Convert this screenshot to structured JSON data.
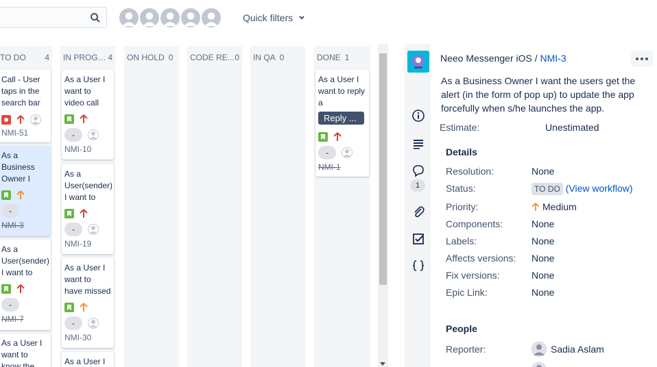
{
  "toolbar": {
    "quick_filters_label": "Quick filters"
  },
  "columns": [
    {
      "name": "TO DO",
      "count": "4"
    },
    {
      "name": "IN PROGR...",
      "count": "4"
    },
    {
      "name": "ON HOLD",
      "count": "0"
    },
    {
      "name": "CODE RE...",
      "count": "0"
    },
    {
      "name": "IN QA",
      "count": "0"
    },
    {
      "name": "DONE",
      "count": "1"
    }
  ],
  "cards": {
    "todo": [
      {
        "summary": "Call - User taps in the search bar",
        "key": "NMI-51"
      },
      {
        "summary": "As a Business Owner I",
        "estimate": "-",
        "key": "NMI-3"
      },
      {
        "summary": "As a User(sender) I want to",
        "estimate": "-",
        "key": "NMI-7"
      },
      {
        "summary": "As a User I want to know the"
      }
    ],
    "inprogress": [
      {
        "summary": "As a User I want to video call",
        "estimate": "-",
        "key": "NMI-10"
      },
      {
        "summary": "As a User(sender) I want to",
        "estimate": "-",
        "key": "NMI-19"
      },
      {
        "summary": "As a User I want to have missed",
        "estimate": "-",
        "key": "NMI-30"
      },
      {
        "summary": "As a User I"
      }
    ],
    "done": [
      {
        "summary": "As a User I want to reply a",
        "button": "Reply ...",
        "estimate": "-",
        "key": "NMI-1"
      }
    ]
  },
  "detail": {
    "project": "Neeo Messenger iOS",
    "separator": "/",
    "issue_key": "NMI-3",
    "summary": "As a Business Owner I want the users get the alert (in the form of pop up) to update the app forcefully when s/he launches the app.",
    "comment_count": "1",
    "estimate_label": "Estimate:",
    "estimate_value": "Unestimated",
    "details_title": "Details",
    "fields": {
      "resolution_label": "Resolution:",
      "resolution_value": "None",
      "status_label": "Status:",
      "status_value": "TO DO",
      "status_link": "(View workflow)",
      "priority_label": "Priority:",
      "priority_value": "Medium",
      "components_label": "Components:",
      "components_value": "None",
      "labels_label": "Labels:",
      "labels_value": "None",
      "affects_label": "Affects versions:",
      "affects_value": "None",
      "fix_label": "Fix versions:",
      "fix_value": "None",
      "epic_label": "Epic Link:",
      "epic_value": "None"
    },
    "people_title": "People",
    "reporter_label": "Reporter:",
    "reporter_value": "Sadia Aslam"
  },
  "colors": {
    "link": "#0052cc",
    "story": "#63ba3c",
    "bug": "#e5493a",
    "priority_high": "#d04437",
    "priority_medium": "#f79232",
    "selected_card": "#deebff"
  },
  "icons": {
    "search": "search-icon",
    "info": "info-icon",
    "description": "description-icon",
    "comment": "comment-icon",
    "attachment": "paperclip-icon",
    "subtasks": "checkbox-icon",
    "development": "braces-icon"
  }
}
